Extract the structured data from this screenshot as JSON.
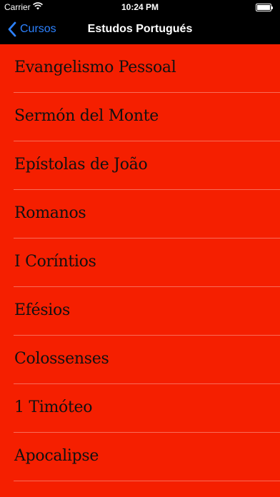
{
  "status_bar": {
    "carrier": "Carrier",
    "time": "10:24 PM"
  },
  "nav": {
    "back_label": "Cursos",
    "title": "Estudos Portugués"
  },
  "items": [
    {
      "label": "Evangelismo Pessoal"
    },
    {
      "label": "Sermón del Monte"
    },
    {
      "label": "Epístolas de João"
    },
    {
      "label": "Romanos"
    },
    {
      "label": "I Coríntios"
    },
    {
      "label": "Efésios"
    },
    {
      "label": "Colossenses"
    },
    {
      "label": "1 Timóteo"
    },
    {
      "label": "Apocalipse"
    }
  ],
  "colors": {
    "background": "#f51f00",
    "bar": "#000000",
    "accent": "#2d82ff"
  }
}
